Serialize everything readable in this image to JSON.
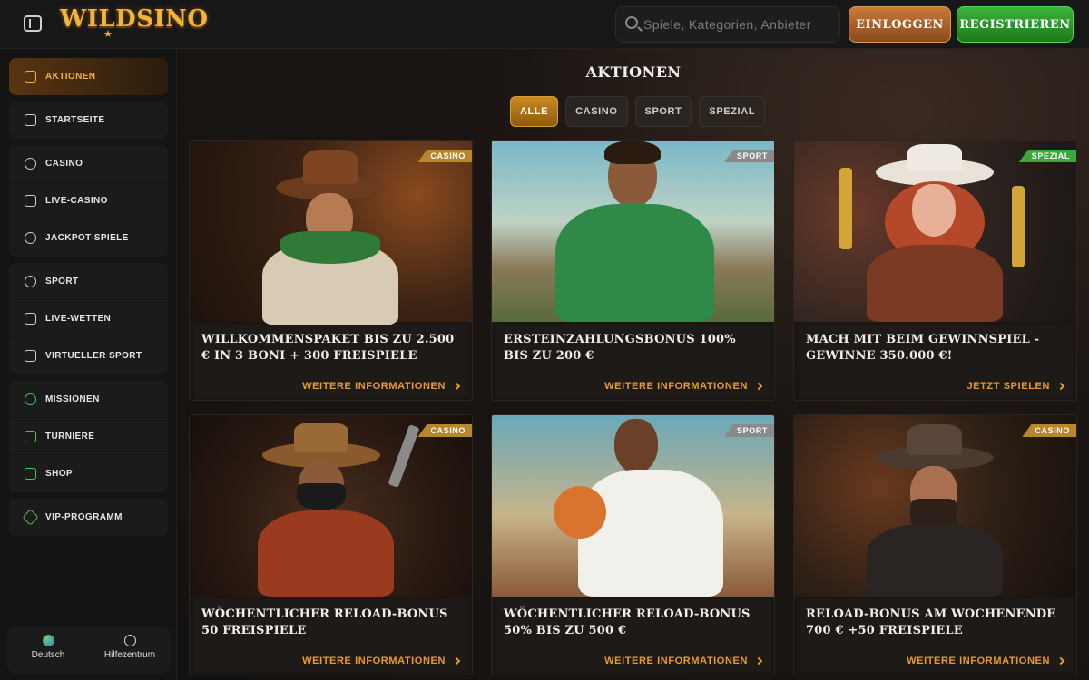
{
  "header": {
    "logo": "WILDSINO",
    "search_placeholder": "Spiele, Kategorien, Anbieter",
    "login_label": "EINLOGGEN",
    "register_label": "REGISTRIEREN"
  },
  "sidebar": {
    "groups": [
      [
        {
          "label": "AKTIONEN",
          "icon": "gift-icon",
          "active": true
        }
      ],
      [
        {
          "label": "STARTSEITE",
          "icon": "home-icon"
        }
      ],
      [
        {
          "label": "CASINO",
          "icon": "chip-icon"
        },
        {
          "label": "LIVE-CASINO",
          "icon": "cards-icon"
        },
        {
          "label": "JACKPOT-SPIELE",
          "icon": "jackpot-icon"
        }
      ],
      [
        {
          "label": "SPORT",
          "icon": "ball-icon"
        },
        {
          "label": "LIVE-WETTEN",
          "icon": "play-icon"
        },
        {
          "label": "VIRTUELLER SPORT",
          "icon": "gamepad-icon"
        }
      ],
      [
        {
          "label": "MISSIONEN",
          "icon": "medal-icon"
        },
        {
          "label": "TURNIERE",
          "icon": "trophy-icon"
        },
        {
          "label": "SHOP",
          "icon": "shop-icon"
        }
      ],
      [
        {
          "label": "VIP-PROGRAMM",
          "icon": "diamond-icon"
        }
      ]
    ],
    "footer": {
      "language_label": "Deutsch",
      "help_label": "Hilfezentrum"
    }
  },
  "main": {
    "title": "AKTIONEN",
    "filters": [
      "ALLE",
      "CASINO",
      "SPORT",
      "SPEZIAL"
    ],
    "active_filter": "ALLE",
    "cards": [
      {
        "badge": "CASINO",
        "title": "WILLKOMMENSPAKET BIS ZU 2.500 € IN 3 BONI + 300 FREISPIELE",
        "link": "WEITERE INFORMATIONEN"
      },
      {
        "badge": "SPORT",
        "title": "ERSTEINZAHLUNGSBONUS 100% BIS ZU 200 €",
        "link": "WEITERE INFORMATIONEN"
      },
      {
        "badge": "SPEZIAL",
        "title": "MACH MIT BEIM GEWINNSPIEL - GEWINNE 350.000 €!",
        "link": "JETZT SPIELEN"
      },
      {
        "badge": "CASINO",
        "title": "WÖCHENTLICHER RELOAD-BONUS 50 FREISPIELE",
        "link": "WEITERE INFORMATIONEN"
      },
      {
        "badge": "SPORT",
        "title": "WÖCHENTLICHER RELOAD-BONUS 50% BIS ZU 500 €",
        "link": "WEITERE INFORMATIONEN"
      },
      {
        "badge": "CASINO",
        "title": "RELOAD-BONUS AM WOCHENENDE 700 € +50 FREISPIELE",
        "link": "WEITERE INFORMATIONEN"
      }
    ]
  },
  "colors": {
    "accent": "#f2b33a",
    "badge_casino": "#b8862c",
    "badge_sport": "#8a8a8a",
    "badge_spezial": "#3aa83a",
    "register_green": "#2e9e2e",
    "login_copper": "#b56a30"
  }
}
